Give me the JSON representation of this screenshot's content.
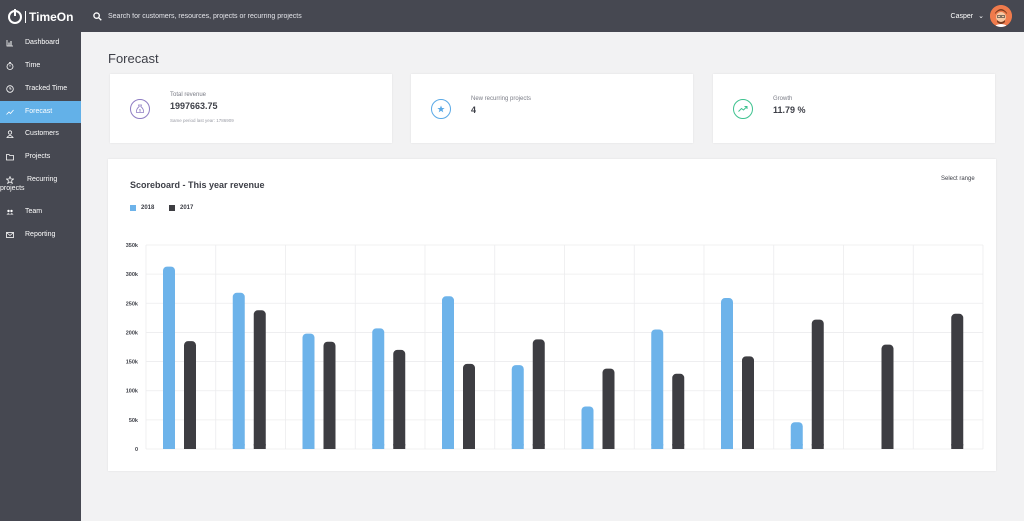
{
  "app": {
    "name": "TimeOn"
  },
  "search": {
    "placeholder": "Search for customers, resources, projects or recurring projects"
  },
  "user": {
    "name": "Casper"
  },
  "sidebar": {
    "items": [
      {
        "label": "Dashboard",
        "icon": "bar-chart-icon",
        "active": false
      },
      {
        "label": "Time",
        "icon": "stopwatch-icon",
        "active": false
      },
      {
        "label": "Tracked Time",
        "icon": "clock-icon",
        "active": false
      },
      {
        "label": "Forecast",
        "icon": "trend-line-icon",
        "active": true
      },
      {
        "label": "Customers",
        "icon": "person-icon",
        "active": false
      },
      {
        "label": "Projects",
        "icon": "folder-icon",
        "active": false
      },
      {
        "label": "Recurring projects",
        "icon": "star-icon",
        "active": false
      },
      {
        "label": "Team",
        "icon": "team-icon",
        "active": false
      },
      {
        "label": "Reporting",
        "icon": "envelope-icon",
        "active": false
      }
    ]
  },
  "page": {
    "title": "Forecast"
  },
  "kpis": {
    "total_revenue": {
      "label": "Total revenue",
      "value": "1997663.75",
      "sub": "Same period last year: 1786909",
      "icon": "money-bag-icon",
      "color": "#8e7cc3"
    },
    "new_recurring": {
      "label": "New recurring projects",
      "value": "4",
      "icon": "star-icon",
      "color": "#5aa9e6"
    },
    "growth": {
      "label": "Growth",
      "value": "11.79 %",
      "icon": "trending-up-icon",
      "color": "#3ec28f"
    }
  },
  "scoreboard": {
    "title": "Scoreboard - This year revenue",
    "select_range": "Select range"
  },
  "colors": {
    "accent": "#63b1e8",
    "sidebar": "#464851",
    "series_2018": "#6db3ea",
    "series_2017": "#3d3d42"
  },
  "chart_data": {
    "type": "bar",
    "categories": [
      "",
      "",
      "",
      "",
      "",
      "",
      "",
      "",
      "",
      "",
      "",
      ""
    ],
    "series": [
      {
        "name": "2018",
        "values": [
          313000,
          268000,
          198000,
          207000,
          262000,
          144000,
          73000,
          205000,
          259000,
          46000,
          null,
          null
        ]
      },
      {
        "name": "2017",
        "values": [
          185000,
          238000,
          184000,
          170000,
          146000,
          188000,
          138000,
          129000,
          159000,
          222000,
          179000,
          232000
        ]
      }
    ],
    "yticks": [
      "0",
      "50k",
      "100k",
      "150k",
      "200k",
      "250k",
      "300k",
      "350k"
    ],
    "ylim": [
      0,
      350000
    ],
    "grid": true,
    "legend": "top-left"
  }
}
